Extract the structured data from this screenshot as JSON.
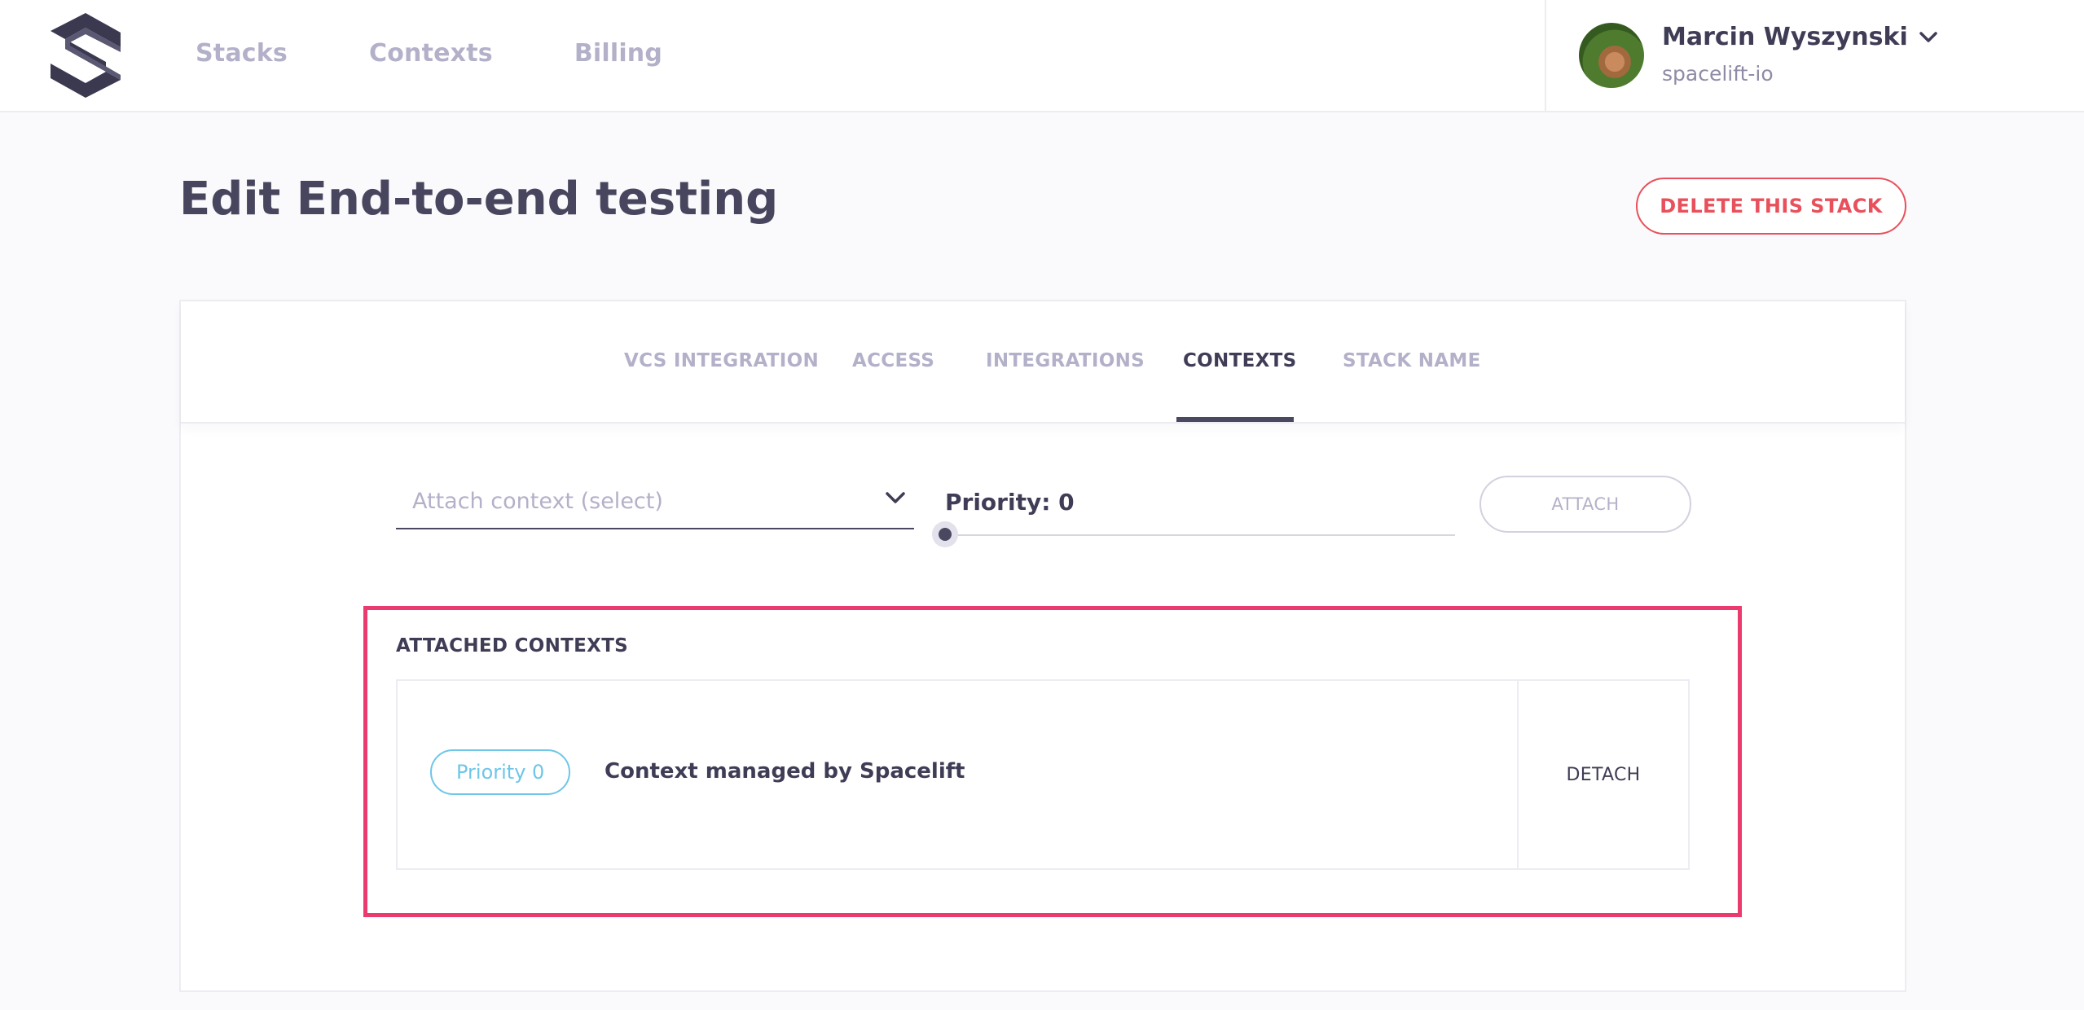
{
  "header": {
    "nav": [
      {
        "label": "Stacks"
      },
      {
        "label": "Contexts"
      },
      {
        "label": "Billing"
      }
    ],
    "user": {
      "name": "Marcin Wyszynski",
      "org": "spacelift-io"
    }
  },
  "page": {
    "title": "Edit End-to-end testing",
    "delete_label": "DELETE THIS STACK"
  },
  "tabs": [
    {
      "label": "VCS INTEGRATION",
      "active": false
    },
    {
      "label": "ACCESS",
      "active": false
    },
    {
      "label": "INTEGRATIONS",
      "active": false
    },
    {
      "label": "CONTEXTS",
      "active": true
    },
    {
      "label": "STACK NAME",
      "active": false
    }
  ],
  "attach_form": {
    "select_placeholder": "Attach context (select)",
    "priority_label": "Priority: 0",
    "priority_value": 0,
    "attach_label": "ATTACH"
  },
  "attached": {
    "title": "ATTACHED CONTEXTS",
    "items": [
      {
        "priority_badge": "Priority 0",
        "name": "Context managed by Spacelift",
        "detach_label": "DETACH"
      }
    ]
  },
  "colors": {
    "accent_dark": "#4a4860",
    "danger": "#e8505b",
    "highlight": "#ea3a6e",
    "badge": "#6ec6e8",
    "muted": "#b3b1c9"
  }
}
